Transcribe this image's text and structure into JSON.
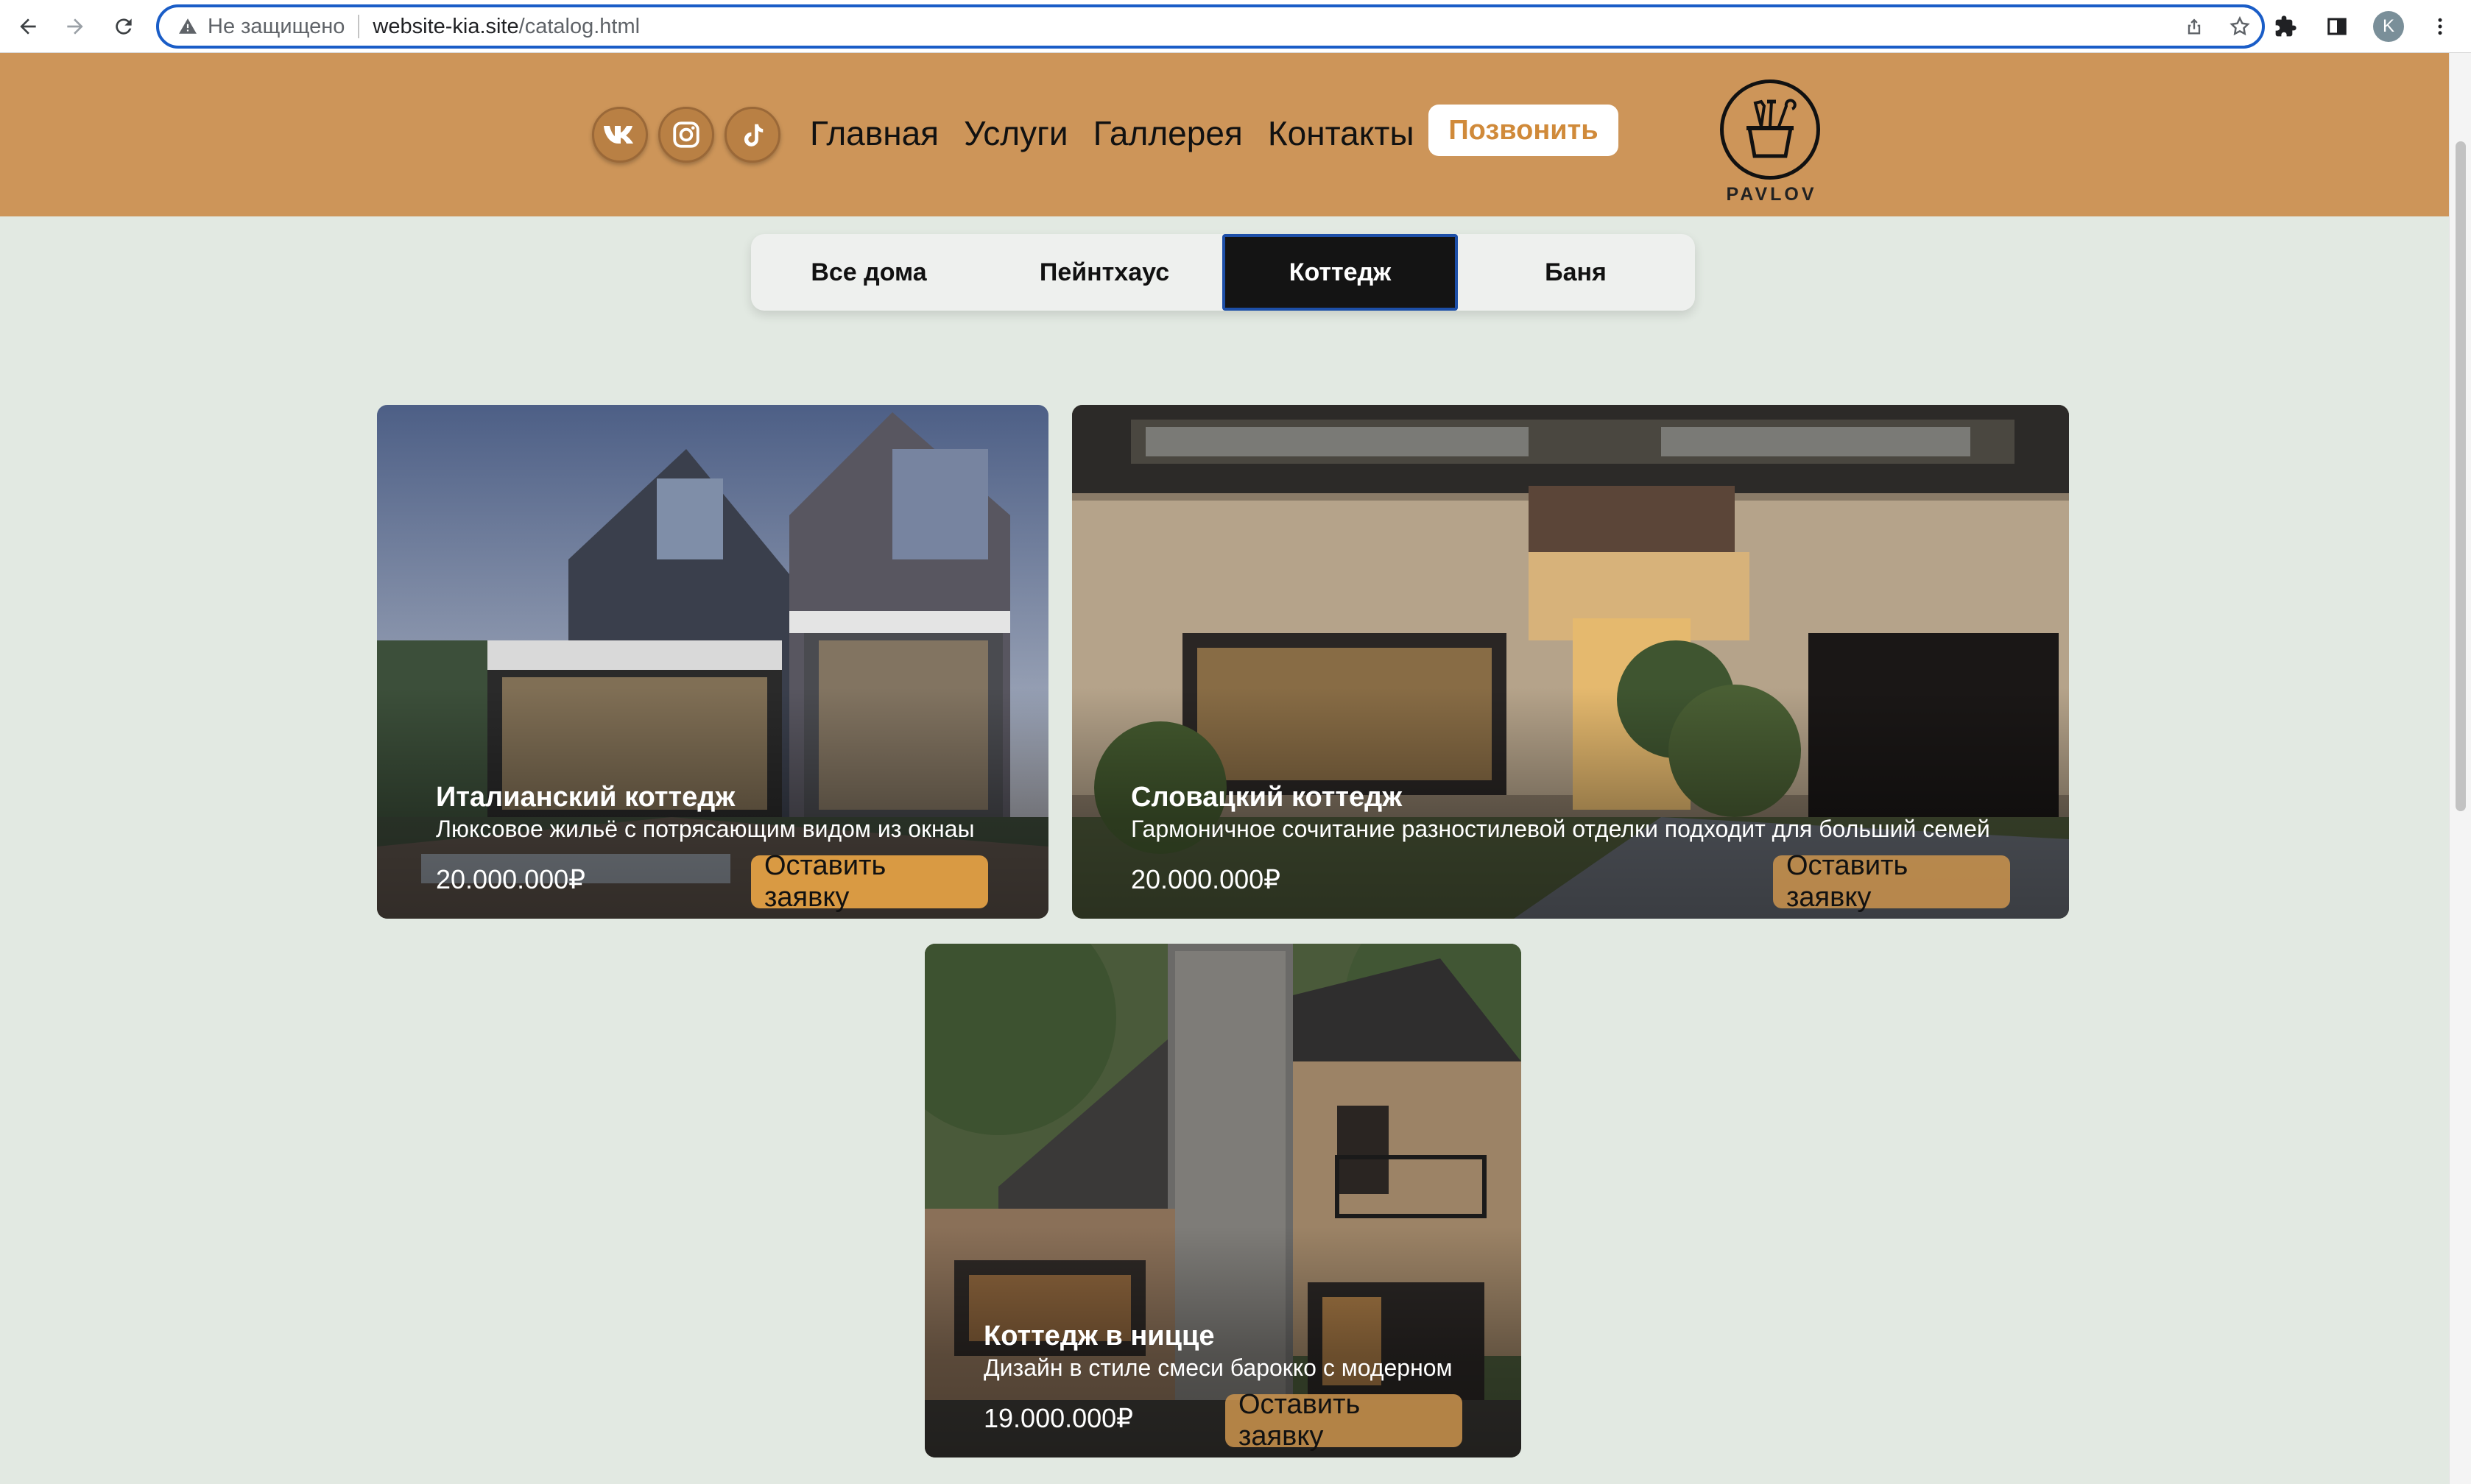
{
  "browser": {
    "insecure_label": "Не защищено",
    "url_host": "website-kia.site",
    "url_path": "/catalog.html",
    "profile_initial": "K"
  },
  "header": {
    "menu": [
      "Главная",
      "Услуги",
      "Галлерея",
      "Контакты"
    ],
    "call_button": "Позвонить",
    "logo_text": "PAVLOV",
    "social": [
      "vk-icon",
      "instagram-icon",
      "tiktok-icon"
    ]
  },
  "filters": {
    "tabs": [
      "Все дома",
      "Пейнтхаус",
      "Коттедж",
      "Баня"
    ],
    "active": "Коттедж"
  },
  "cards": [
    {
      "title": "Италианский коттедж",
      "description": "Люксовое жильё с потрясающим видом из окнаы",
      "price": "20.000.000₽",
      "button": "Оставить заявку"
    },
    {
      "title": "Словацкий коттедж",
      "description": "Гармоничное сочитание разностилевой отделки подходит для больший семей",
      "price": "20.000.000₽",
      "button": "Оставить заявку"
    },
    {
      "title": "Коттедж в ницце",
      "description": "Дизайн в стиле смеси барокко с модерном",
      "price": "19.000.000₽",
      "button": "Оставить заявку"
    }
  ],
  "colors": {
    "header_bg": "#cd9559",
    "page_bg": "#e2e9e2",
    "accent_button": "#d99a43",
    "active_tab": "#141414"
  }
}
